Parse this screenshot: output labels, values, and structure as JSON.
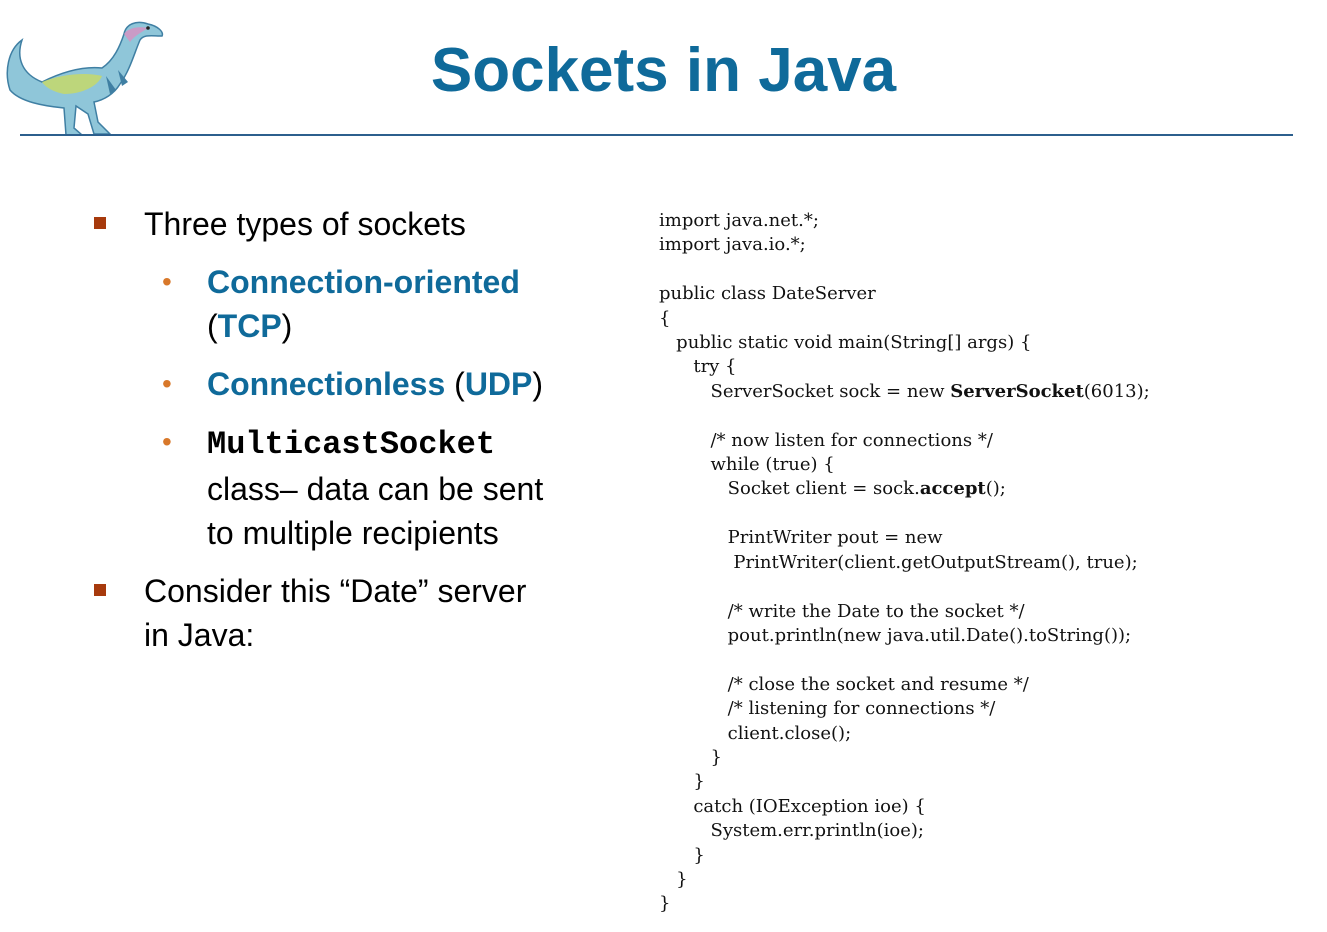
{
  "title": "Sockets in Java",
  "logo": {
    "icon": "dinosaur-logo"
  },
  "bullets": {
    "item1": "Three types of sockets",
    "sub1": {
      "label": "Connection-oriented",
      "open": "(",
      "proto": "TCP",
      "close": ")"
    },
    "sub2": {
      "label": "Connectionless",
      "open": " (",
      "proto": "UDP",
      "close": ")"
    },
    "sub3": {
      "code": "MulticastSocket",
      "line2": "class– data can be sent",
      "line3": "to multiple recipients"
    },
    "item2_line1": "Consider this “Date” server",
    "item2_line2": "in Java:"
  },
  "code": {
    "l1": "import java.net.*;",
    "l2": "import java.io.*;",
    "l3": "",
    "l4": "public class DateServer",
    "l5": "{",
    "l6": "   public static void main(String[] args) {",
    "l7": "      try {",
    "l8_pre": "         ServerSocket sock = new ",
    "l8_bold": "ServerSocket",
    "l8_post": "(6013);",
    "l9": "",
    "l10": "         /* now listen for connections */",
    "l11": "         while (true) {",
    "l12_pre": "            Socket client = sock.",
    "l12_bold": "accept",
    "l12_post": "();",
    "l13": "",
    "l14": "            PrintWriter pout = new",
    "l15": "             PrintWriter(client.getOutputStream(), true);",
    "l16": "",
    "l17": "            /* write the Date to the socket */",
    "l18": "            pout.println(new java.util.Date().toString());",
    "l19": "",
    "l20": "            /* close the socket and resume */",
    "l21": "            /* listening for connections */",
    "l22": "            client.close();",
    "l23": "         }",
    "l24": "      }",
    "l25": "      catch (IOException ioe) {",
    "l26": "         System.err.println(ioe);",
    "l27": "      }",
    "l28": "   }",
    "l29": "}"
  },
  "colors": {
    "title": "#0f6a9a",
    "bullet_square": "#a73a0c",
    "bullet_dot": "#d8782a",
    "rule": "#2c5f8d"
  }
}
